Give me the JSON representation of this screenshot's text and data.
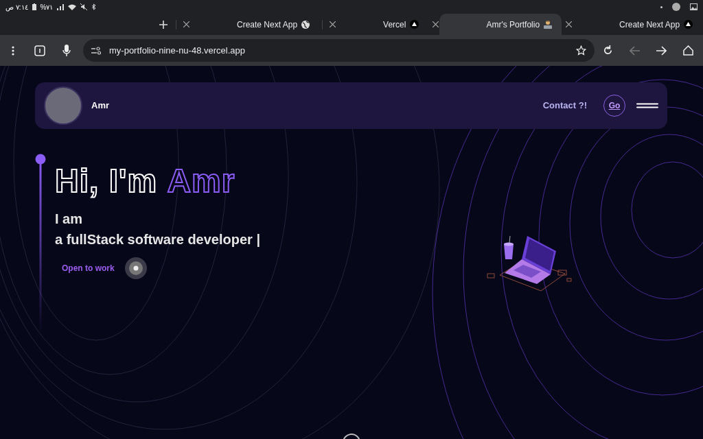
{
  "status_bar": {
    "time": "ص ٧:١٤",
    "battery": "%٧١"
  },
  "tabs": [
    {
      "label": "Create Next App",
      "kind": "globe",
      "selected": false
    },
    {
      "label": "Vercel",
      "kind": "triangle",
      "selected": false
    },
    {
      "label": "Amr's Portfolio",
      "kind": "person",
      "selected": true
    },
    {
      "label": "Create Next App",
      "kind": "triangle",
      "selected": false
    }
  ],
  "address_bar": {
    "url": "my-portfolio-nine-nu-48.vercel.app"
  },
  "navbar": {
    "name": "Amr",
    "contact": "Contact ?!",
    "go_button": "Go"
  },
  "hero": {
    "greeting": "Hi, I'm ",
    "name": "Amr",
    "intro": "I am",
    "role": "a fullStack software developer |",
    "status": "Open to work"
  }
}
